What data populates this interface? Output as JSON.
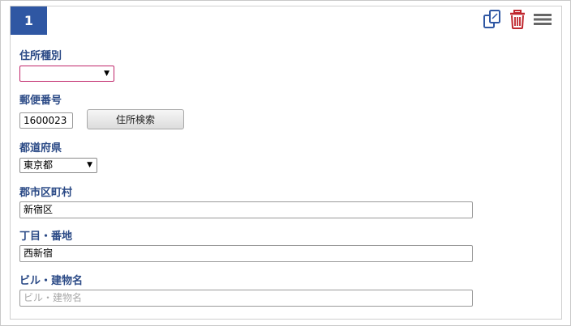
{
  "card": {
    "number": "1",
    "icons": {
      "copy": "copy-icon",
      "trash": "trash-icon",
      "menu": "hamburger-menu-icon"
    },
    "accent_color": "#2f57a3",
    "trash_color": "#c0262d"
  },
  "form": {
    "address_type": {
      "label": "住所種別",
      "value": ""
    },
    "postal_code": {
      "label": "郵便番号",
      "value": "1600023",
      "search_button": "住所検索"
    },
    "prefecture": {
      "label": "都道府県",
      "value": "東京都"
    },
    "city": {
      "label": "郡市区町村",
      "value": "新宿区"
    },
    "block": {
      "label": "丁目・番地",
      "value": "西新宿"
    },
    "building": {
      "label": "ビル・建物名",
      "value": "",
      "placeholder": "ビル・建物名"
    }
  }
}
